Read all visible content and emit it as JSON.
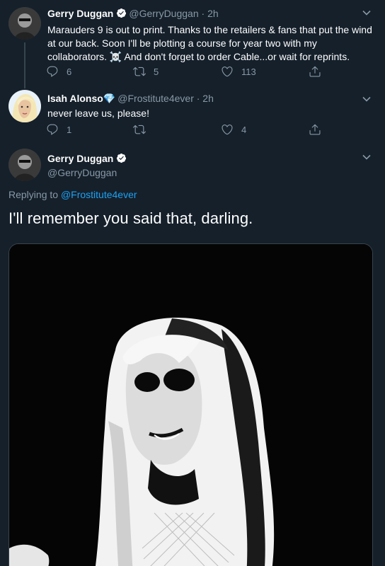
{
  "tweets": [
    {
      "name": "Gerry Duggan",
      "handle": "@GerryDuggan",
      "time": "· 2h",
      "text": "Marauders 9 is out to print. Thanks to the retailers & fans that put the wind at our back. Soon I'll be plotting a course for year two with my collaborators. ☠️ And don't forget to order Cable...or wait for reprints.",
      "replies": "6",
      "retweets": "5",
      "likes": "113"
    },
    {
      "name": "Isah Alonso",
      "name_emoji": "💎",
      "handle": "@Frostitute4ever",
      "time": "· 2h",
      "text": "never leave us, please!",
      "replies": "1",
      "retweets": "",
      "likes": "4"
    }
  ],
  "main_tweet": {
    "name": "Gerry Duggan",
    "handle": "@GerryDuggan",
    "replying_prefix": "Replying to ",
    "replying_to": "@Frostitute4ever",
    "text": "I'll remember you said that, darling."
  },
  "icons": {
    "verified": "verified-badge-icon",
    "reply": "reply-icon",
    "retweet": "retweet-icon",
    "like": "heart-icon",
    "share": "share-icon",
    "more": "chevron-down-icon"
  },
  "colors": {
    "background": "#15202b",
    "secondary_text": "#8899a6",
    "link": "#1da1f2",
    "divider": "#38444d"
  }
}
